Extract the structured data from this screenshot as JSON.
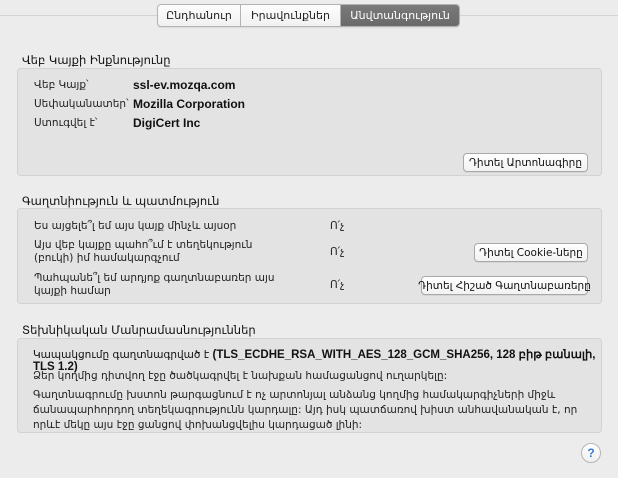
{
  "tabs": [
    {
      "label": "Ընդհանուր"
    },
    {
      "label": "Իրավունքներ"
    },
    {
      "label": "Անվտանգություն"
    }
  ],
  "identity": {
    "title": "Վեբ Կայքի Ինքնությունը",
    "website_label": "Վեբ Կայք՝",
    "website_value": "ssl-ev.mozqa.com",
    "owner_label": "Սեփականատեր՝",
    "owner_value": "Mozilla Corporation",
    "verified_label": "Ստուգվել է՝",
    "verified_value": "DigiCert Inc",
    "view_cert_button": "Դիտել Արտոնագիրը"
  },
  "privacy": {
    "title": "Գաղտնիություն և պատմություն",
    "q1": "Ես այցելե՞լ եմ այս կայք մինչև այսօր",
    "a1": "Ո՛չ",
    "q2": "Այս վեբ կայքը պահո՞ւմ է տեղեկություն (բուկի) իմ համակարգչում",
    "a2": "Ո՛չ",
    "cookies_button": "Դիտել Cookie-ները",
    "q3": "Պահպանե՞լ եմ արդյոք գաղտնաբառեր այս կայքի համար",
    "a3": "Ո՛չ",
    "passwords_button": "Դիտել Հիշած Գաղտնաբառերը"
  },
  "technical": {
    "title": "Տեխնիկական Մանրամասնություններ",
    "connection_prefix": "Կապակցումը գաղտնագրված է",
    "connection_detail": "(TLS_ECDHE_RSA_WITH_AES_128_GCM_SHA256, 128 բիթ բանալի, TLS 1.2)",
    "para1": "Ձեր կողմից դիտվող էջը ծածկագրվել է նախքան համացանցով ուղարկելը:",
    "para2": "Գաղտնագրումը խստոն թարգացնում է ոչ արտոնյալ անձանց կողմից համակարգիչների միջև ճանապարհորդող տեղեկագրությունն կարդալը: Այդ իսկ պատճառով խիստ անհավանական է, որ որևէ մեկը այս էջը ցանցով փոխանցվելիս կարդացած լինի:"
  },
  "help_button": "?"
}
